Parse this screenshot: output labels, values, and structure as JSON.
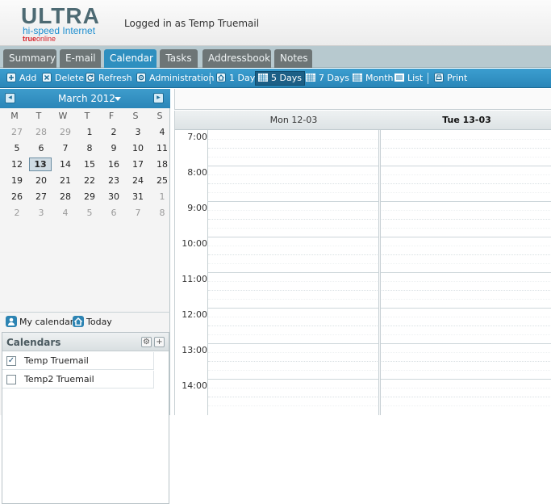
{
  "header": {
    "logo_title": "ULTRA",
    "logo_subtitle": "hi-speed Internet",
    "logo_brand_1": "true",
    "logo_brand_2": "online",
    "login_text": "Logged in as Temp Truemail"
  },
  "tabs": [
    {
      "label": "Summary",
      "active": false
    },
    {
      "label": "E-mail",
      "active": false
    },
    {
      "label": "Calendar",
      "active": true
    },
    {
      "label": "Tasks",
      "active": false
    },
    {
      "label": "Addressbook",
      "active": false
    },
    {
      "label": "Notes",
      "active": false
    }
  ],
  "toolbar": {
    "add": "Add",
    "delete": "Delete",
    "refresh": "Refresh",
    "administration": "Administration",
    "one_day": "1 Day",
    "five_days": "5 Days",
    "seven_days": "7 Days",
    "month": "Month",
    "list": "List",
    "print": "Print",
    "selected_view": "5 Days"
  },
  "mini_calendar": {
    "month_label": "March 2012",
    "weekdays": [
      "M",
      "T",
      "W",
      "T",
      "F",
      "S",
      "S"
    ],
    "weeks": [
      [
        {
          "d": "27",
          "o": true
        },
        {
          "d": "28",
          "o": true
        },
        {
          "d": "29",
          "o": true
        },
        {
          "d": "1"
        },
        {
          "d": "2"
        },
        {
          "d": "3"
        },
        {
          "d": "4"
        }
      ],
      [
        {
          "d": "5"
        },
        {
          "d": "6"
        },
        {
          "d": "7"
        },
        {
          "d": "8"
        },
        {
          "d": "9"
        },
        {
          "d": "10"
        },
        {
          "d": "11"
        }
      ],
      [
        {
          "d": "12"
        },
        {
          "d": "13",
          "today": true
        },
        {
          "d": "14"
        },
        {
          "d": "15"
        },
        {
          "d": "16"
        },
        {
          "d": "17"
        },
        {
          "d": "18"
        }
      ],
      [
        {
          "d": "19"
        },
        {
          "d": "20"
        },
        {
          "d": "21"
        },
        {
          "d": "22"
        },
        {
          "d": "23"
        },
        {
          "d": "24"
        },
        {
          "d": "25"
        }
      ],
      [
        {
          "d": "26"
        },
        {
          "d": "27"
        },
        {
          "d": "28"
        },
        {
          "d": "29"
        },
        {
          "d": "30"
        },
        {
          "d": "31"
        },
        {
          "d": "1",
          "o": true
        }
      ],
      [
        {
          "d": "2",
          "o": true
        },
        {
          "d": "3",
          "o": true
        },
        {
          "d": "4",
          "o": true
        },
        {
          "d": "5",
          "o": true
        },
        {
          "d": "6",
          "o": true
        },
        {
          "d": "7",
          "o": true
        },
        {
          "d": "8",
          "o": true
        }
      ]
    ]
  },
  "quick_links": {
    "my_calendar": "My calendar",
    "today": "Today"
  },
  "calendars_panel": {
    "title": "Calendars",
    "items": [
      {
        "name": "Temp Truemail",
        "checked": true
      },
      {
        "name": "Temp2 Truemail",
        "checked": false
      }
    ]
  },
  "calendar_view": {
    "day_columns": [
      {
        "label": "Mon 12-03",
        "current": false
      },
      {
        "label": "Tue 13-03",
        "current": true
      }
    ],
    "hours": [
      "7:00",
      "8:00",
      "9:00",
      "10:00",
      "11:00",
      "12:00",
      "13:00",
      "14:00"
    ]
  },
  "colors": {
    "accent": "#2e8fbf",
    "tab_inactive": "#6d7576",
    "tabbar_bg": "#b7c9cf"
  }
}
